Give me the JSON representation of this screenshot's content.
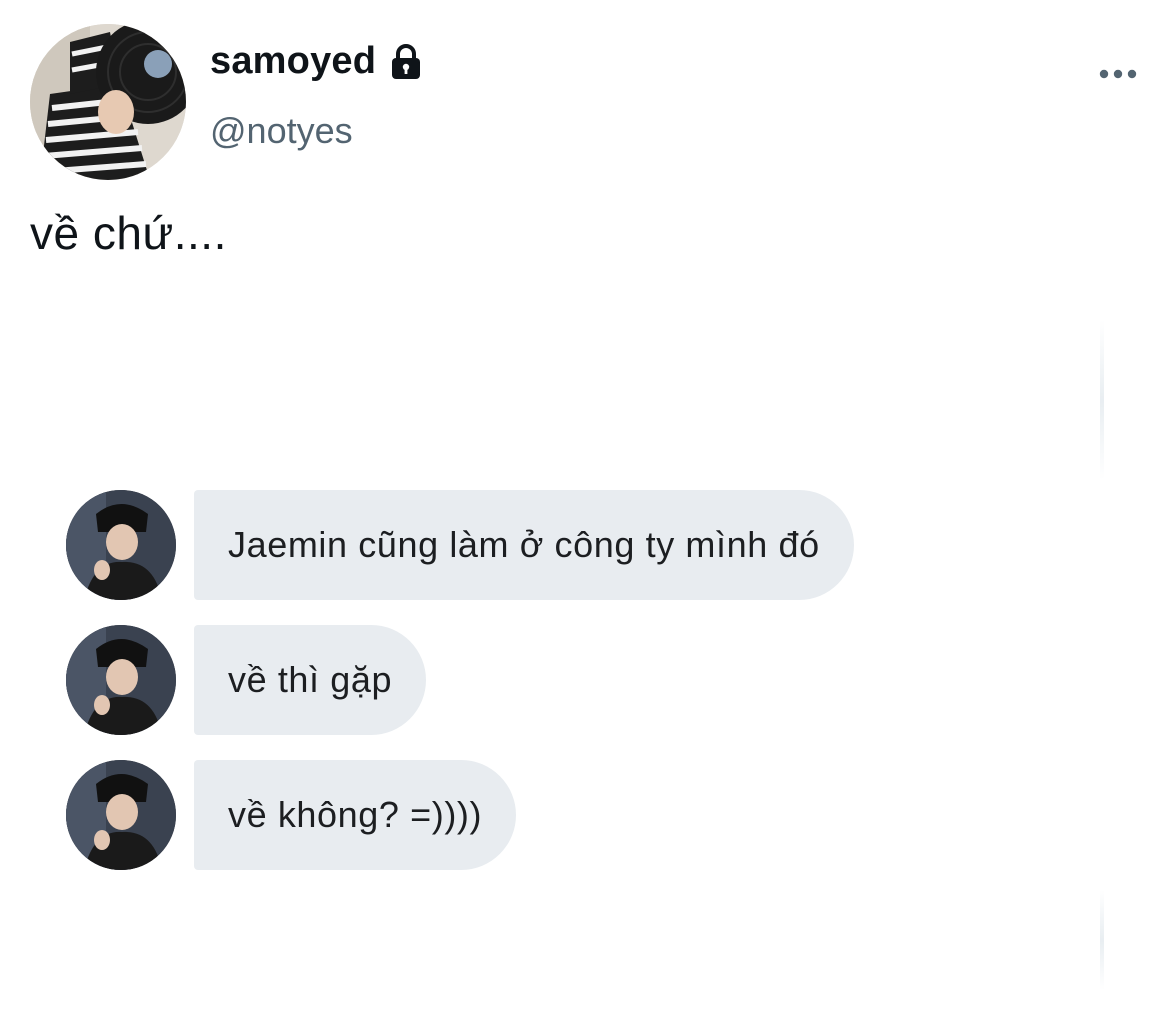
{
  "tweet": {
    "display_name": "samoyed",
    "handle": "@notyes",
    "text": "về chứ....",
    "icons": {
      "lock": "lock-icon",
      "more": "more-horizontal-icon"
    }
  },
  "conversation": {
    "messages": [
      {
        "text": "Jaemin cũng làm ở công ty mình đó"
      },
      {
        "text": "về thì gặp"
      },
      {
        "text": "về không? =))))"
      }
    ]
  },
  "colors": {
    "handle": "#536471",
    "bubble": "#e8ecf0",
    "text": "#0f1419"
  }
}
